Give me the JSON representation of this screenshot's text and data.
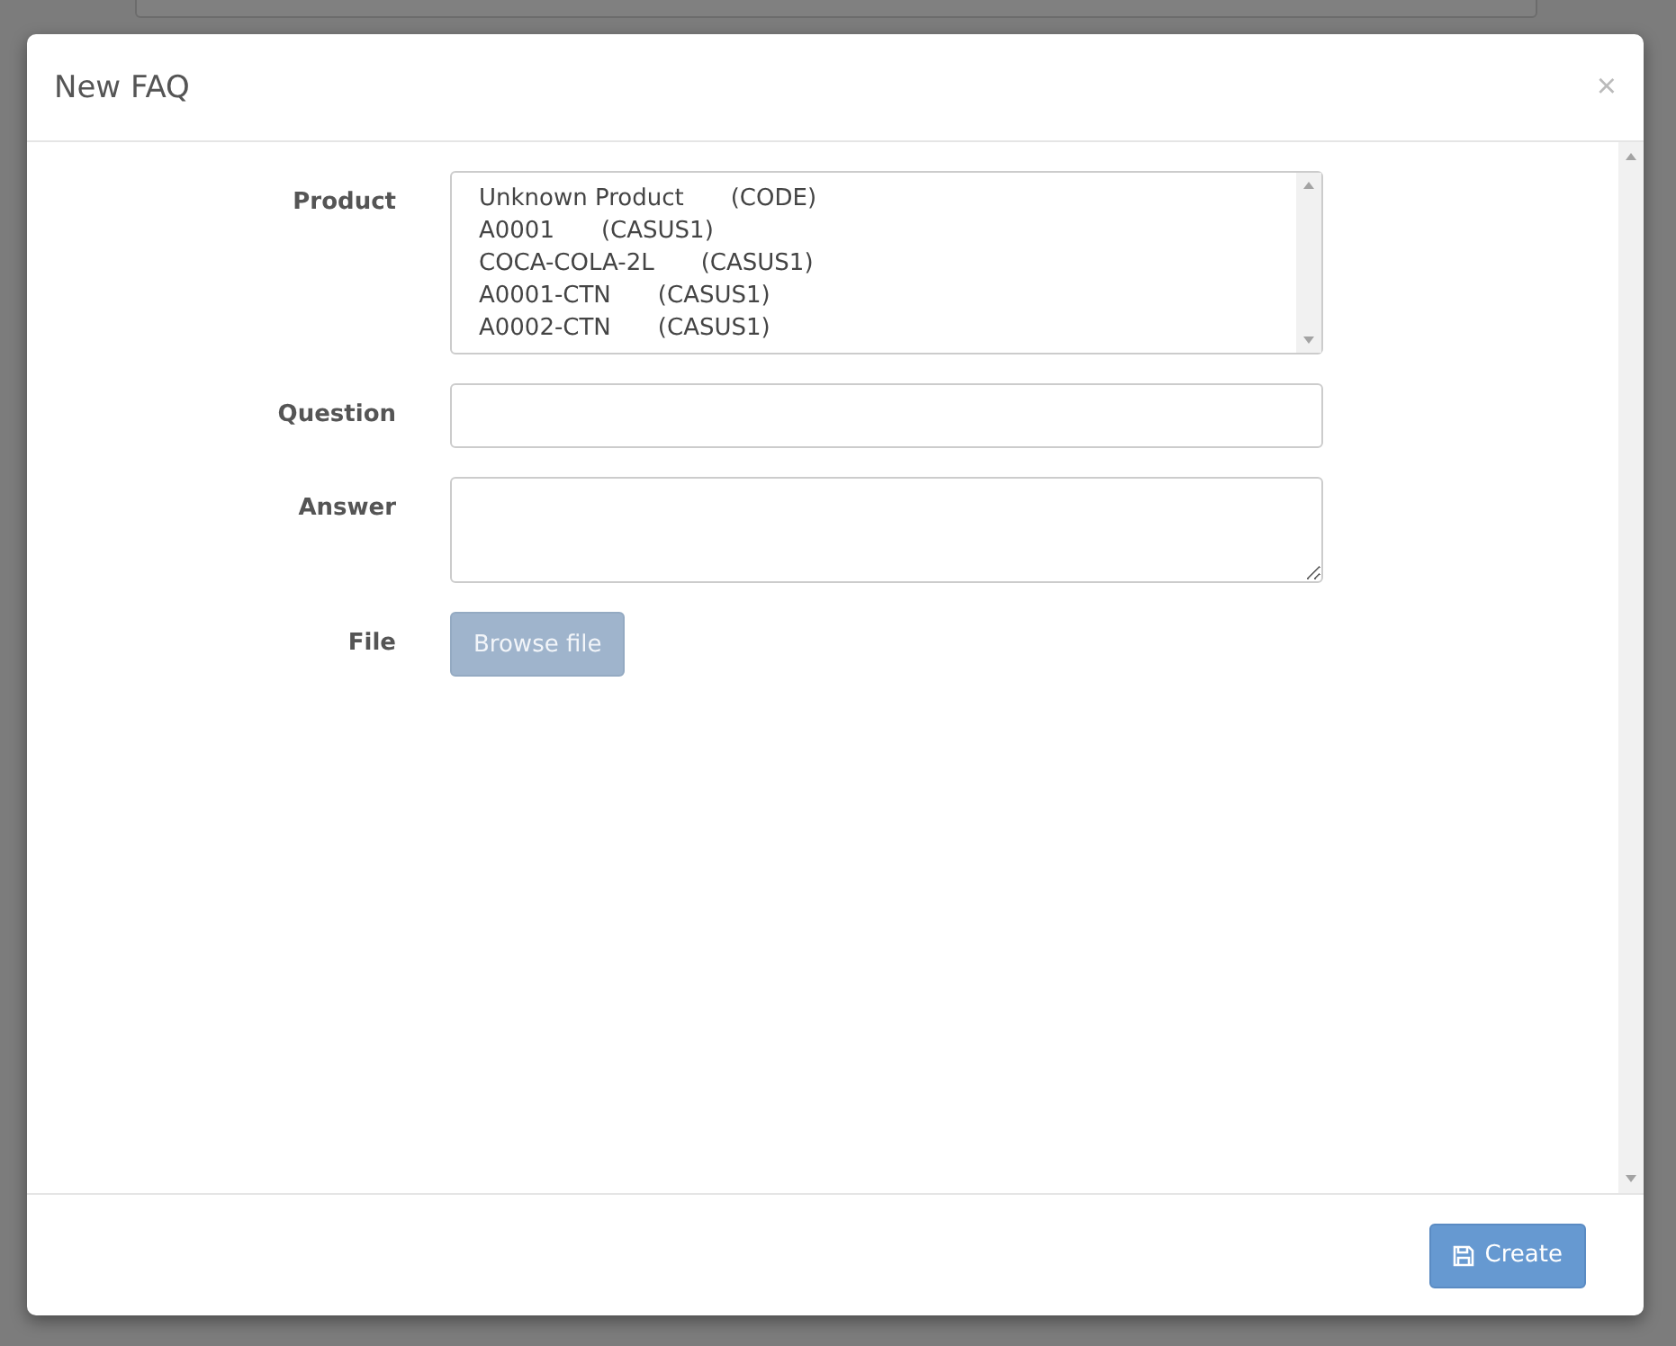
{
  "modal": {
    "title": "New FAQ",
    "close": "×"
  },
  "form": {
    "product": {
      "label": "Product",
      "options": [
        {
          "name": "Unknown Product",
          "code": "(CODE)"
        },
        {
          "name": "A0001",
          "code": "(CASUS1)"
        },
        {
          "name": "COCA-COLA-2L",
          "code": "(CASUS1)"
        },
        {
          "name": "A0001-CTN",
          "code": "(CASUS1)"
        },
        {
          "name": "A0002-CTN",
          "code": "(CASUS1)"
        }
      ]
    },
    "question": {
      "label": "Question"
    },
    "answer": {
      "label": "Answer"
    },
    "file": {
      "label": "File",
      "button": "Browse file",
      "disabled": true
    }
  },
  "footer": {
    "button": "Create"
  }
}
